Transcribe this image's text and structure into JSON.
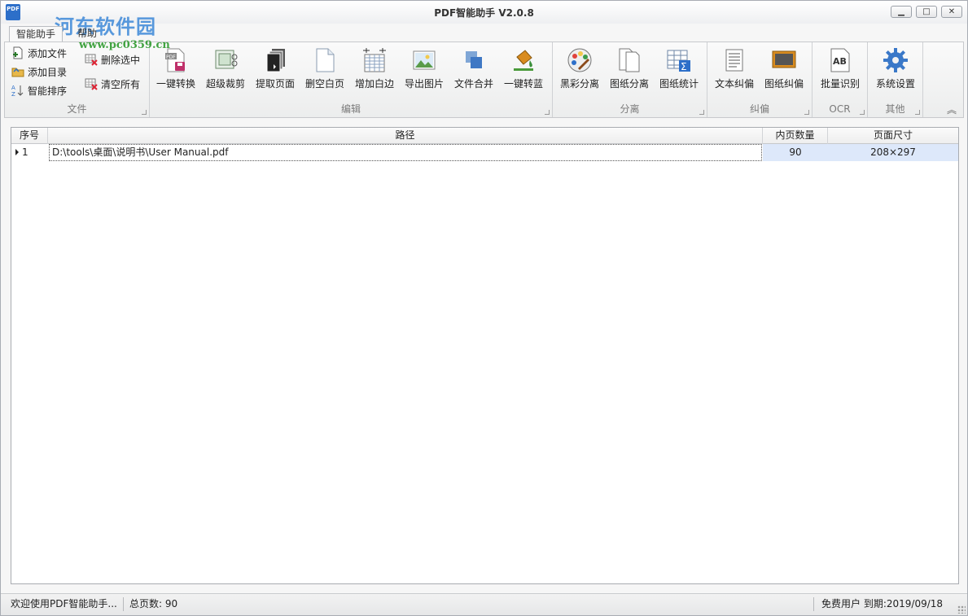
{
  "window": {
    "title": "PDF智能助手 V2.0.8",
    "watermark": "河东软件园",
    "watermark_url": "www.pc0359.cn",
    "app_icon_text": "PDF",
    "min_symbol": "▁",
    "max_symbol": "□",
    "close_symbol": "✕"
  },
  "tabs": [
    {
      "label": "智能助手",
      "active": true
    },
    {
      "label": "帮助",
      "active": false
    }
  ],
  "ribbon": {
    "file_group": {
      "label": "文件",
      "add_file": "添加文件",
      "add_dir": "添加目录",
      "smart_sort": "智能排序",
      "delete_selected": "删除选中",
      "clear_all": "清空所有"
    },
    "edit_group": {
      "label": "编辑",
      "buttons": [
        "一键转换",
        "超级裁剪",
        "提取页面",
        "删空白页",
        "增加白边",
        "导出图片",
        "文件合并",
        "一键转蓝"
      ]
    },
    "split_group": {
      "label": "分离",
      "buttons": [
        "黑彩分离",
        "图纸分离",
        "图纸统计"
      ]
    },
    "deskew_group": {
      "label": "纠偏",
      "buttons": [
        "文本纠偏",
        "图纸纠偏"
      ]
    },
    "ocr_group": {
      "label": "OCR",
      "buttons": [
        "批量识别"
      ],
      "icon_text": "AB"
    },
    "other_group": {
      "label": "其他",
      "buttons": [
        "系统设置"
      ]
    },
    "collapse_symbol": "︽"
  },
  "grid": {
    "columns": [
      "序号",
      "路径",
      "内页数量",
      "页面尺寸"
    ],
    "rows": [
      {
        "index": "1",
        "path": "D:\\tools\\桌面\\说明书\\User Manual.pdf",
        "pages": "90",
        "size": "208×297"
      }
    ]
  },
  "status": {
    "welcome": "欢迎使用PDF智能助手...",
    "total_pages": "总页数: 90",
    "license": "免费用户 到期:2019/09/18"
  }
}
